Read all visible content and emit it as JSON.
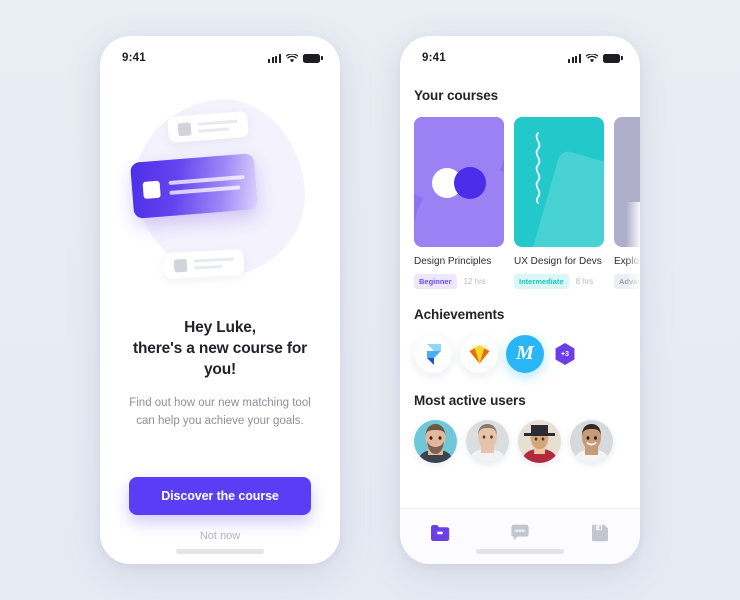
{
  "canvas": {
    "background": "#e8ecf5"
  },
  "theme": {
    "primary": "#5b3df5",
    "purple_deep": "#4b2ce8",
    "teal": "#23c9ca",
    "muted_lavender": "#aeaecb",
    "text_dark": "#22232a",
    "text_muted": "#8d8f9b"
  },
  "status_bar": {
    "time": "9:41",
    "signal_icon": "cellular-bars-icon",
    "wifi_icon": "wifi-icon",
    "battery_icon": "battery-full-icon"
  },
  "left_screen": {
    "name": "new-course-promo-screen",
    "illustration": {
      "name": "course-cards-illustration",
      "blob_color": "#f4f2fd",
      "main_card_gradient": [
        "#4c2fe8",
        "#ddd5fc"
      ],
      "ghost_cards": 2
    },
    "headline_line1": "Hey Luke,",
    "headline_line2": "there's a new course for you!",
    "subtext_line1": "Find out how our new matching tool",
    "subtext_line2": "can help you achieve your goals.",
    "primary_button": "Discover the course",
    "secondary_link": "Not now"
  },
  "right_screen": {
    "name": "dashboard-screen",
    "courses_section": {
      "title": "Your courses",
      "items": [
        {
          "title": "Design Principles",
          "level": "Beginner",
          "duration": "12 hrs",
          "thumb_style": "purple-circles",
          "badge_bg": "#ece7fd",
          "badge_fg": "#6b4df0"
        },
        {
          "title": "UX Design for Devs",
          "level": "Intermediate",
          "duration": "8 hrs",
          "thumb_style": "teal-squiggle",
          "badge_bg": "#d8f7f5",
          "badge_fg": "#1ec2c3"
        },
        {
          "title": "Explore",
          "level": "Advanced",
          "duration": "",
          "thumb_style": "lavender-sheet",
          "badge_bg": "#eceef3",
          "badge_fg": "#9aa0ae"
        }
      ]
    },
    "achievements_section": {
      "title": "Achievements",
      "items": [
        {
          "name": "framer-badge",
          "label": "Framer"
        },
        {
          "name": "sketch-badge",
          "label": "Sketch"
        },
        {
          "name": "marvel-badge",
          "label": "M"
        }
      ],
      "more_count": "+3"
    },
    "users_section": {
      "title": "Most active users",
      "avatars": [
        {
          "name": "avatar-bearded-man",
          "bg": "#6ec8d8",
          "skin": "#e2b79a",
          "hair": "#6d5646",
          "shirt": "#3c4250"
        },
        {
          "name": "avatar-woman-lace",
          "bg": "#dcdde1",
          "skin": "#e8c3ab",
          "hair": "#8a7a6a",
          "shirt": "#f2f2f4"
        },
        {
          "name": "avatar-woman-hat",
          "bg": "#e6dfd4",
          "skin": "#eec5a6",
          "hair": "#c69a6a",
          "shirt": "#b32a3c"
        },
        {
          "name": "avatar-smiling-man",
          "bg": "#d8d9dd",
          "skin": "#c79a78",
          "hair": "#332a26",
          "shirt": "#f4f4f6"
        }
      ]
    },
    "tab_bar": {
      "tabs": [
        {
          "name": "tab-courses",
          "icon": "folder-icon",
          "active": true
        },
        {
          "name": "tab-messages",
          "icon": "chat-icon",
          "active": false
        },
        {
          "name": "tab-saved",
          "icon": "save-icon",
          "active": false
        }
      ]
    }
  }
}
